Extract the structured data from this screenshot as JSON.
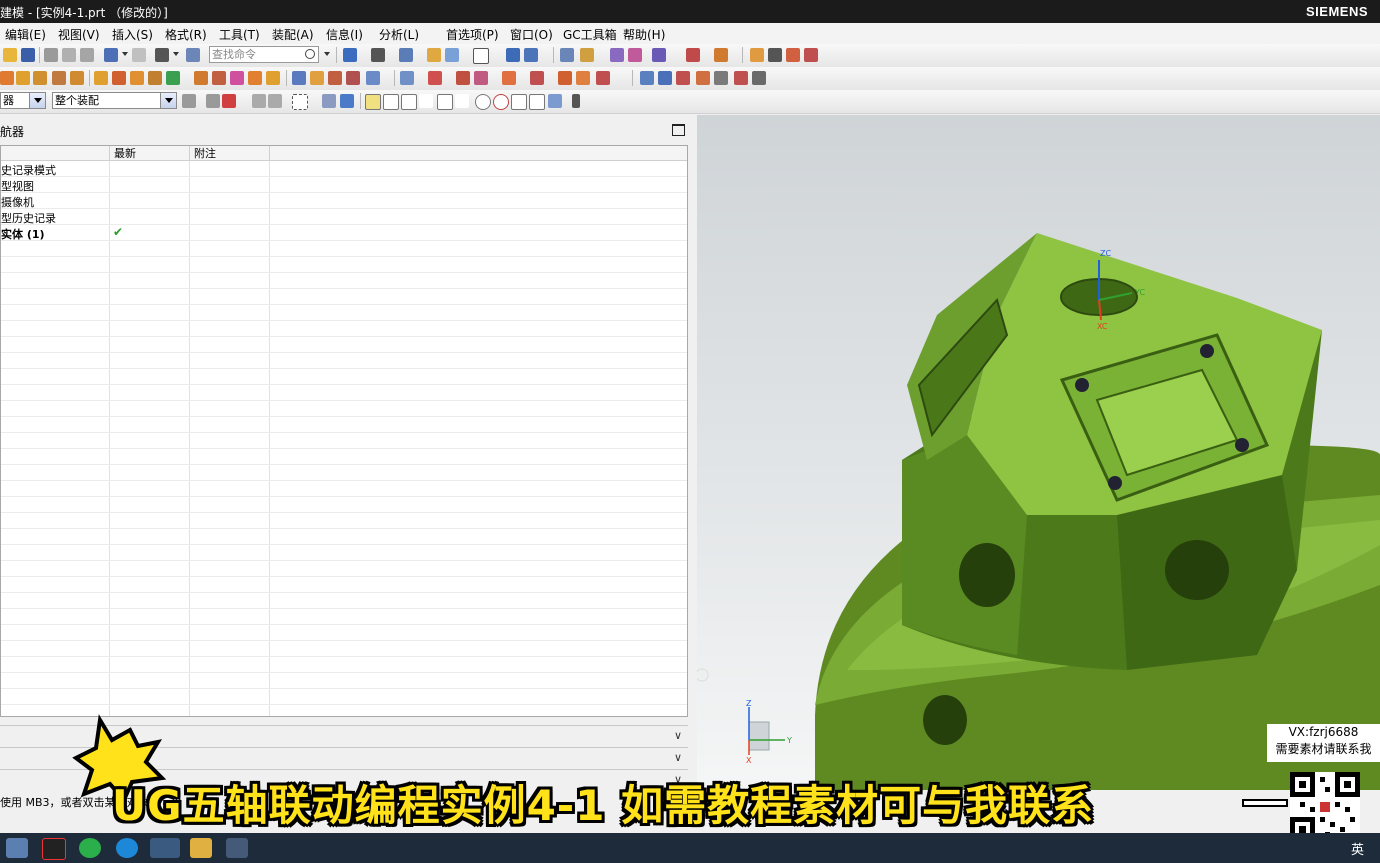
{
  "window": {
    "title": "建模 - [实例4-1.prt （修改的）]",
    "brand": "SIEMENS"
  },
  "menu": {
    "items": [
      "编辑(E)",
      "视图(V)",
      "插入(S)",
      "格式(R)",
      "工具(T)",
      "装配(A)",
      "信息(I)",
      "分析(L)",
      "首选项(P)",
      "窗口(O)",
      "GC工具箱",
      "帮助(H)"
    ]
  },
  "toolbar": {
    "search_placeholder": "查找命令",
    "filter_select": "器",
    "assembly_select": "整个装配"
  },
  "navigator": {
    "title": "航器",
    "columns": [
      "",
      "最新",
      "附注"
    ],
    "rows": [
      {
        "name": "史记录模式",
        "latest": ""
      },
      {
        "name": "型视图",
        "latest": ""
      },
      {
        "name": "摄像机",
        "latest": ""
      },
      {
        "name": "型历史记录",
        "latest": ""
      },
      {
        "name": "实体 (1)",
        "latest": "✔"
      }
    ]
  },
  "viewport": {
    "model_color": "#6e9a2a",
    "axis_labels": {
      "zc": "ZC",
      "xc": "XC",
      "yc": "YC",
      "z": "Z",
      "y": "Y",
      "x": "X"
    }
  },
  "statusbar": {
    "text": "使用 MB3，或者双击某一对象"
  },
  "overlay": {
    "caption": "UG五轴联动编程实例4-1 如需教程素材可与我联系",
    "contact_line1": "VX:fzrj6688",
    "contact_line2": "需要素材请联系我"
  },
  "taskbar": {
    "lang": "英"
  }
}
